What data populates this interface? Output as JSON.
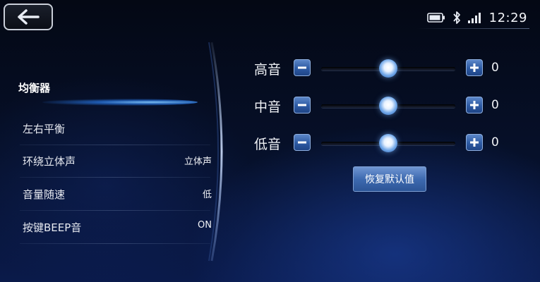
{
  "status_bar": {
    "time": "12:29",
    "icons": [
      "battery-icon",
      "bluetooth-icon",
      "signal-icon"
    ]
  },
  "menu": {
    "items": [
      {
        "label": "均衡器",
        "value": "",
        "active": true
      },
      {
        "label": "左右平衡",
        "value": ""
      },
      {
        "label": "环绕立体声",
        "value": "立体声"
      },
      {
        "label": "音量随速",
        "value": "低"
      },
      {
        "label": "按键BEEP音",
        "value": "ON"
      }
    ]
  },
  "equalizer": {
    "bands": [
      {
        "name": "高音",
        "value": "0",
        "level": 0.5
      },
      {
        "name": "中音",
        "value": "0",
        "level": 0.5
      },
      {
        "name": "低音",
        "value": "0",
        "level": 0.5
      }
    ],
    "reset_label": "恢复默认值"
  },
  "colors": {
    "accent": "#3e6ab0",
    "highlight": "#6fb8ff",
    "background": "#06102a"
  }
}
